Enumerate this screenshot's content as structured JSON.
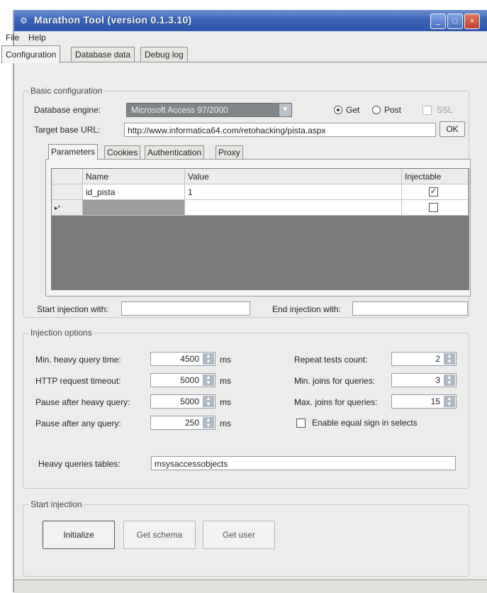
{
  "window": {
    "title": "Marathon Tool  (version 0.1.3.10)",
    "controls": {
      "minimize": "_",
      "maximize": "□",
      "close": "×"
    }
  },
  "menu": {
    "file": "File",
    "help": "Help"
  },
  "tabs": {
    "configuration": "Configuration",
    "database_data": "Database data",
    "debug_log": "Debug log"
  },
  "basic": {
    "legend": "Basic configuration",
    "db_engine_label": "Database engine:",
    "db_engine_value": "Microsoft Access 97/2000",
    "get_label": "Get",
    "post_label": "Post",
    "ssl_label": "SSL",
    "url_label": "Target base URL:",
    "url_value": "http://www.informatica64.com/retohacking/pista.aspx",
    "ok_label": "OK",
    "subtabs": {
      "parameters": "Parameters",
      "cookies": "Cookies",
      "authentication": "Authentication",
      "proxy": "Proxy"
    },
    "grid": {
      "headers": {
        "name": "Name",
        "value": "Value",
        "injectable": "Injectable"
      },
      "row1": {
        "name": "id_pista",
        "value": "1",
        "injectable_mark": "✓"
      },
      "new_row_marker": "▸*"
    },
    "start_injection_label": "Start injection with:",
    "end_injection_label": "End injection with:"
  },
  "injection": {
    "legend": "Injection options",
    "min_heavy_label": "Min. heavy query time:",
    "min_heavy_value": "4500",
    "http_timeout_label": "HTTP request timeout:",
    "http_timeout_value": "5000",
    "pause_heavy_label": "Pause after heavy query:",
    "pause_heavy_value": "5000",
    "pause_any_label": "Pause after any query:",
    "pause_any_value": "250",
    "unit_ms": "ms",
    "repeat_label": "Repeat tests count:",
    "repeat_value": "2",
    "min_joins_label": "Min. joins for queries:",
    "min_joins_value": "3",
    "max_joins_label": "Max. joins for queries:",
    "max_joins_value": "15",
    "equal_sign_label": "Enable equal sign in selects",
    "heavy_tables_label": "Heavy queries tables:",
    "heavy_tables_value": "msysaccessobjects"
  },
  "start": {
    "legend": "Start injection",
    "initialize": "Initialize",
    "get_schema": "Get schema",
    "get_user": "Get user"
  },
  "icons": {
    "spin_up": "▲",
    "spin_down": "▼",
    "dropdown": "▼",
    "app": "⚙"
  }
}
